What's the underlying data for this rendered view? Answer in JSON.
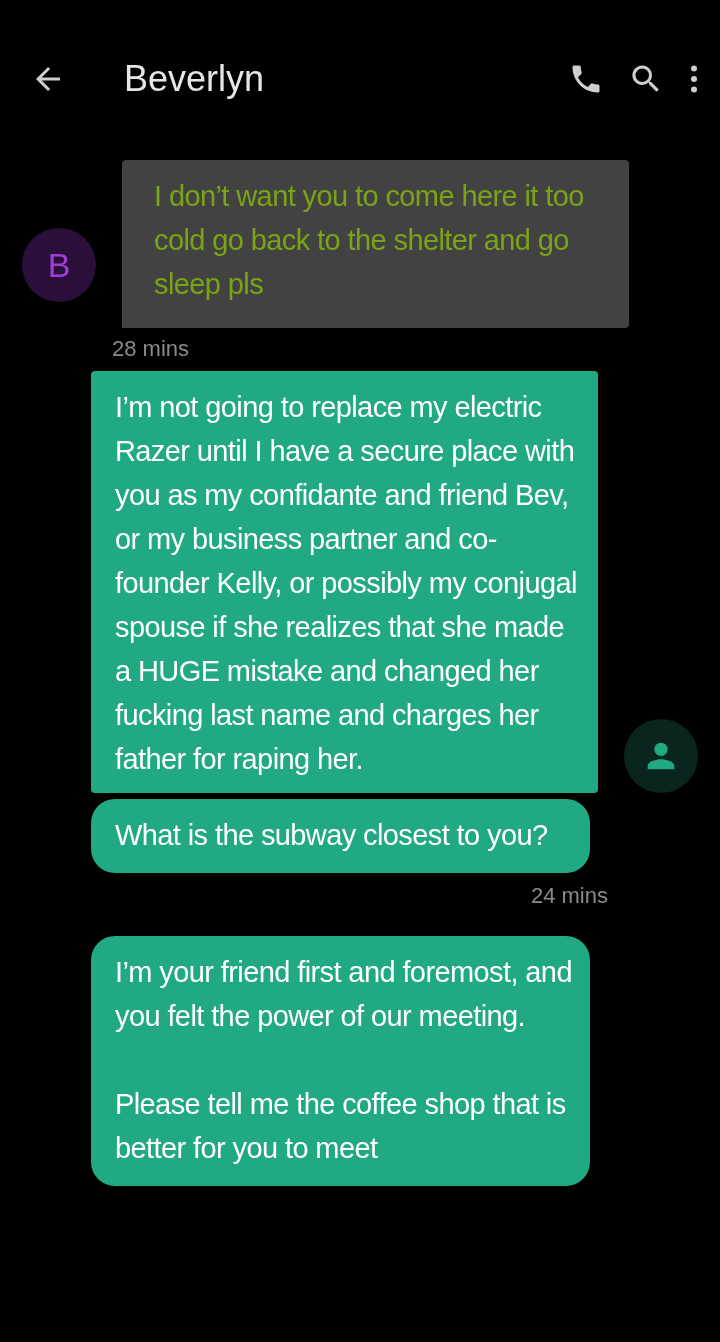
{
  "header": {
    "title": "Beverlyn"
  },
  "contact": {
    "initial": "B"
  },
  "messages": [
    {
      "kind": "incoming",
      "text": "I don’t want you to come here it too cold go back to the shelter and go sleep pls",
      "time": "28 mins",
      "tail": true
    },
    {
      "kind": "outgoing",
      "text": "I’m not going to replace my electric Razer until I have a secure place with you as my confidante and friend Bev, or my business partner and co-founder Kelly, or possibly my conjugal spouse if she realizes that she made a HUGE mistake and changed her fucking last name and charges her father for raping her.",
      "tail": true
    },
    {
      "kind": "outgoing",
      "text": "What is the subway closest to you?",
      "time": "24 mins",
      "tail": false
    },
    {
      "kind": "outgoing",
      "text": "I’m your friend first and foremost, and you felt the power of our meeting.\n\nPlease tell me the coffee shop that is better for you to meet",
      "tail": false
    }
  ]
}
